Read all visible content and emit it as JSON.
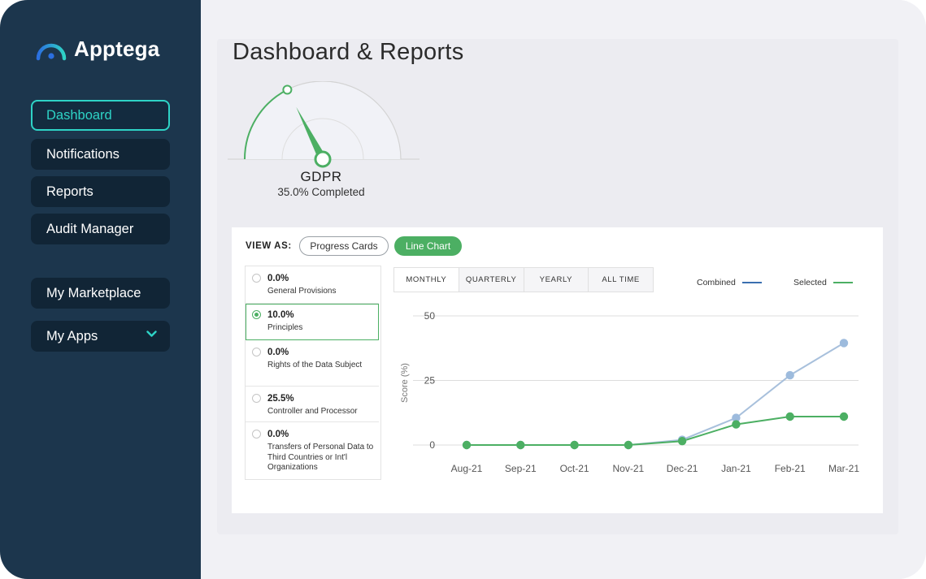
{
  "app": {
    "name": "Apptega"
  },
  "sidebar": {
    "items": [
      {
        "label": "Dashboard",
        "active": true
      },
      {
        "label": "Notifications",
        "active": false
      },
      {
        "label": "Reports",
        "active": false
      },
      {
        "label": "Audit Manager",
        "active": false
      },
      {
        "label": "My Marketplace",
        "active": false
      },
      {
        "label": "My Apps",
        "active": false,
        "has_dropdown": true
      }
    ]
  },
  "page": {
    "title": "Dashboard & Reports"
  },
  "gauge": {
    "framework": "GDPR",
    "completion_text": "35.0% Completed",
    "completion_fraction": 0.35,
    "accent_color": "#4caf63"
  },
  "report": {
    "view_as_label": "VIEW AS:",
    "view_options": [
      {
        "label": "Progress Cards",
        "selected": false
      },
      {
        "label": "Line Chart",
        "selected": true
      }
    ],
    "sections": [
      {
        "pct": "0.0%",
        "name": "General Provisions",
        "selected": false
      },
      {
        "pct": "10.0%",
        "name": "Principles",
        "selected": true
      },
      {
        "pct": "0.0%",
        "name": "Rights of the Data Subject",
        "selected": false
      },
      {
        "pct": "25.5%",
        "name": "Controller and Processor",
        "selected": false
      },
      {
        "pct": "0.0%",
        "name": "Transfers of Personal Data to Third Countries or Int'l Organizations",
        "selected": false
      }
    ],
    "tabs": [
      {
        "label": "MONTHLY",
        "active": true
      },
      {
        "label": "QUARTERLY",
        "active": false
      },
      {
        "label": "YEARLY",
        "active": false
      },
      {
        "label": "ALL TIME",
        "active": false
      }
    ]
  },
  "chart_data": {
    "type": "line",
    "categories": [
      "Aug-21",
      "Sep-21",
      "Oct-21",
      "Nov-21",
      "Dec-21",
      "Jan-21",
      "Feb-21",
      "Mar-21"
    ],
    "ylabel": "Score (%)",
    "ylim": [
      0,
      50
    ],
    "yticks": [
      0,
      25,
      50
    ],
    "grid": true,
    "legend_position": "top-right",
    "series": [
      {
        "name": "Combined",
        "color": "#3a6fb0",
        "marker_color": "#9dbbdd",
        "line_color": "#a8c0dc",
        "values": [
          0,
          0,
          0,
          0,
          2,
          10.5,
          27,
          39.5
        ]
      },
      {
        "name": "Selected",
        "color": "#4caf63",
        "marker_color": "#4caf63",
        "line_color": "#4caf63",
        "values": [
          0,
          0,
          0,
          0,
          1.5,
          8,
          11,
          11
        ]
      }
    ]
  }
}
